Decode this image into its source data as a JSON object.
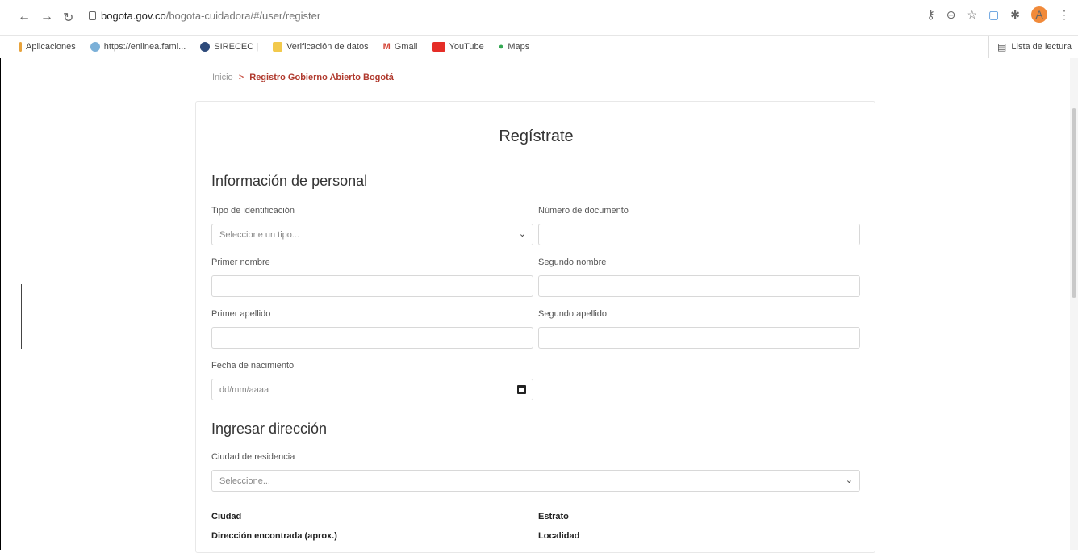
{
  "browser": {
    "url_host": "bogota.gov.co",
    "url_path": "/bogota-cuidadora/#/user/register",
    "profile_initial": "A",
    "bookmarks": [
      {
        "label": "Aplicaciones"
      },
      {
        "label": "https://enlinea.fami..."
      },
      {
        "label": "SIRECEC |"
      },
      {
        "label": "Verificación de datos"
      },
      {
        "label": "Gmail"
      },
      {
        "label": "YouTube"
      },
      {
        "label": "Maps"
      }
    ],
    "reading_list": "Lista de lectura"
  },
  "breadcrumb": {
    "home": "Inicio",
    "separator": ">",
    "current": "Registro Gobierno Abierto Bogotá"
  },
  "form": {
    "title": "Regístrate",
    "personal_section": "Información de personal",
    "id_type_label": "Tipo de identificación",
    "id_type_placeholder": "Seleccione un tipo...",
    "doc_number_label": "Número de documento",
    "first_name_label": "Primer nombre",
    "second_name_label": "Segundo nombre",
    "first_surname_label": "Primer apellido",
    "second_surname_label": "Segundo apellido",
    "birth_date_label": "Fecha de nacimiento",
    "birth_date_placeholder": "dd/mm/aaaa",
    "address_section": "Ingresar dirección",
    "city_label": "Ciudad de residencia",
    "city_placeholder": "Seleccione...",
    "info_city": "Ciudad",
    "info_stratum": "Estrato",
    "info_address": "Dirección encontrada (aprox.)",
    "info_locality": "Localidad"
  },
  "colors": {
    "accent": "#b03a2e",
    "border": "#d8d8d8"
  }
}
